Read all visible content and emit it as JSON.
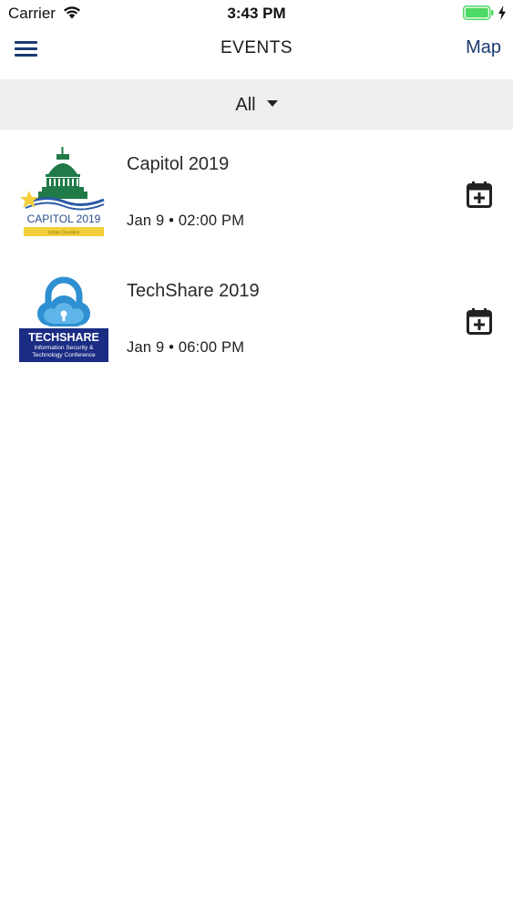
{
  "status_bar": {
    "carrier": "Carrier",
    "time": "3:43 PM",
    "battery_color": "#4cd964"
  },
  "nav": {
    "title": "EVENTS",
    "map_label": "Map",
    "accent_color": "#1b3a73"
  },
  "filter": {
    "selected": "All"
  },
  "events": [
    {
      "title": "Capitol 2019",
      "date": "Jan 9 • 02:00 PM",
      "logo": {
        "icon": "capitol-dome-logo",
        "text": "CAPITOL 2019",
        "subtext": "Urban Counties"
      },
      "action_icon": "calendar-add-icon"
    },
    {
      "title": "TechShare 2019",
      "date": "Jan 9 • 06:00 PM",
      "logo": {
        "icon": "cloud-lock-logo",
        "text": "TECHSHARE",
        "subtext_line1": "Information Security &",
        "subtext_line2": "Technology Conference"
      },
      "action_icon": "calendar-add-icon"
    }
  ]
}
